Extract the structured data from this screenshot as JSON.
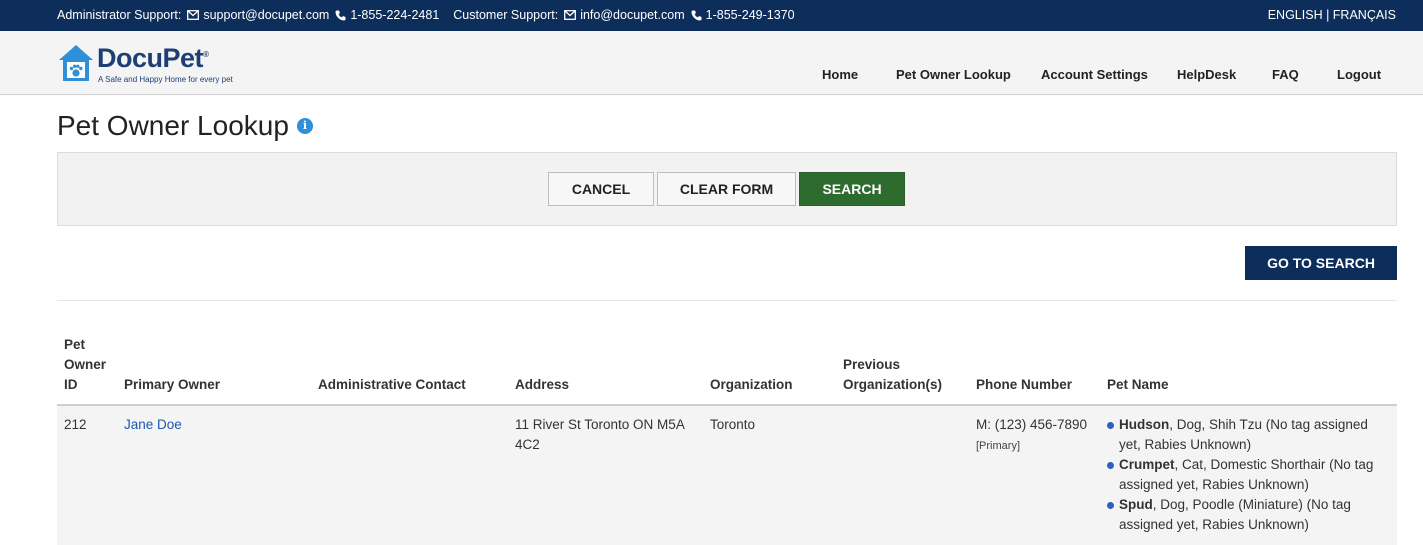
{
  "topbar": {
    "admin_label": "Administrator Support:",
    "admin_email": "support@docupet.com",
    "admin_phone": "1-855-224-2481",
    "customer_label": "Customer Support:",
    "customer_email": "info@docupet.com",
    "customer_phone": "1-855-249-1370",
    "language_switch": "ENGLISH | FRANÇAIS"
  },
  "logo": {
    "name": "DocuPet",
    "tagline": "A Safe and Happy Home for every pet",
    "icon": "house-paw-icon"
  },
  "nav": [
    "Home",
    "Pet Owner Lookup",
    "Account Settings",
    "HelpDesk",
    "FAQ",
    "Logout"
  ],
  "page": {
    "title": "Pet Owner Lookup",
    "info_icon": "info-icon"
  },
  "actions": {
    "cancel": "CANCEL",
    "clear": "CLEAR FORM",
    "search": "SEARCH",
    "go_to_search": "GO TO SEARCH"
  },
  "colors": {
    "topbar": "#0d2d5a",
    "search_button": "#2e6b2e",
    "go_button": "#0d2d5a",
    "link": "#1e57b5",
    "bullet": "#2b5fc4"
  },
  "table": {
    "headers": [
      "Pet Owner ID",
      "Primary Owner",
      "Administrative Contact",
      "Address",
      "Organization",
      "Previous Organization(s)",
      "Phone Number",
      "Pet Name"
    ],
    "rows": [
      {
        "id": "212",
        "primary_owner": "Jane Doe",
        "admin_contact": "",
        "address": "11 River St Toronto ON M5A 4C2",
        "organization": "Toronto",
        "previous_orgs": "",
        "phone": "M: (123) 456-7890",
        "phone_tag": "[Primary]",
        "pets": [
          {
            "name": "Hudson",
            "details": ", Dog, Shih Tzu (No tag assigned yet, Rabies Unknown)"
          },
          {
            "name": "Crumpet",
            "details": ", Cat, Domestic Shorthair (No tag assigned yet, Rabies Unknown)"
          },
          {
            "name": "Spud",
            "details": ", Dog, Poodle (Miniature) (No tag assigned yet, Rabies Unknown)"
          }
        ]
      }
    ]
  }
}
